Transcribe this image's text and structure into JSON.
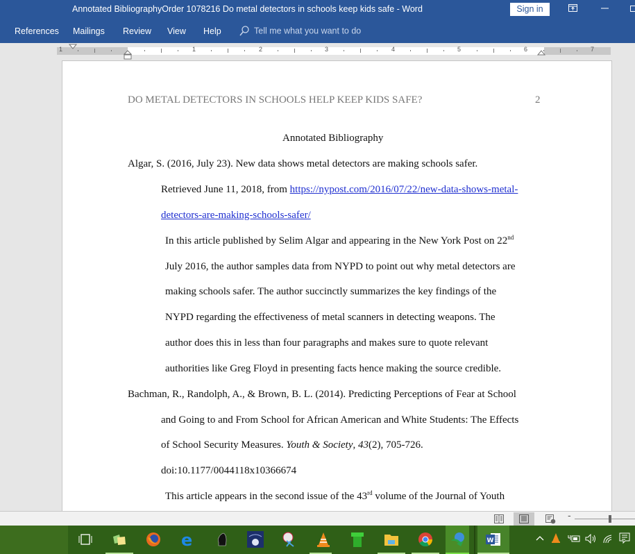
{
  "window": {
    "title": "Annotated BibliographyOrder 1078216 Do metal detectors in schools keep kids safe  -  Word",
    "sign_in": "Sign in",
    "controls": [
      "ribbon-display-options",
      "minimize",
      "restore"
    ]
  },
  "ribbon": {
    "tabs": [
      "References",
      "Mailings",
      "Review",
      "View",
      "Help"
    ],
    "tell_me_placeholder": "Tell me what you want to do"
  },
  "ruler": {
    "labels": [
      "1",
      "1",
      "2",
      "3",
      "4",
      "5",
      "6",
      "7"
    ]
  },
  "document": {
    "running_head": "DO METAL DETECTORS IN SCHOOLS HELP KEEP KIDS SAFE?",
    "page_number": "2",
    "heading": "Annotated Bibliography",
    "entries": [
      {
        "citation_lines": [
          "Algar, S. (2016, July 23). New data shows metal detectors are making schools safer.",
          "Retrieved June 11, 2018, from "
        ],
        "link_part1": "https://nypost.com/2016/07/22/new-data-shows-metal-",
        "link_part2": "detectors-are-making-schools-safer/",
        "annotation_lines": [
          "In this article published by Selim Algar and appearing in the New York Post on 22",
          "July 2016, the author samples data from NYPD to point out why metal detectors are",
          "making schools safer. The author succinctly summarizes the key findings of the",
          "NYPD regarding the effectiveness of metal scanners in detecting weapons. The",
          "author does this in less than four paragraphs and makes sure to quote relevant",
          "authorities like Greg Floyd in presenting facts hence making the source credible."
        ],
        "annotation_sup": "nd"
      },
      {
        "citation_lines": [
          "Bachman, R., Randolph, A., & Brown, B. L. (2014). Predicting Perceptions of Fear at School",
          "and Going to and From School for African American and White Students: The Effects",
          "of School Security Measures. "
        ],
        "journal": "Youth & Society",
        "volume": "43",
        "issue_pages": "(2), 705-726.",
        "doi": "doi:10.1177/0044118x10366674",
        "annotation_start": "This article appears in the second issue of the 43",
        "annotation_sup": "rd",
        "annotation_end": " volume of the Journal of Youth"
      }
    ]
  },
  "statusbar": {
    "views": [
      "read-mode",
      "print-layout",
      "web-layout"
    ],
    "active_view": "print-layout",
    "zoom_minus": "-"
  },
  "taskbar": {
    "apps": [
      "task-view",
      "sticky-notes",
      "firefox",
      "edge",
      "chess",
      "stellarium",
      "snipping-tool",
      "vlc",
      "green-pipe-app",
      "file-explorer",
      "chrome",
      "internet-download-manager",
      "word"
    ],
    "tray": [
      "show-hidden-icons",
      "vlc",
      "battery",
      "volume",
      "wifi",
      "action-center"
    ]
  },
  "colors": {
    "word_blue": "#2b579a",
    "link": "#1f2fd0",
    "taskbar": "#2f5f17"
  }
}
